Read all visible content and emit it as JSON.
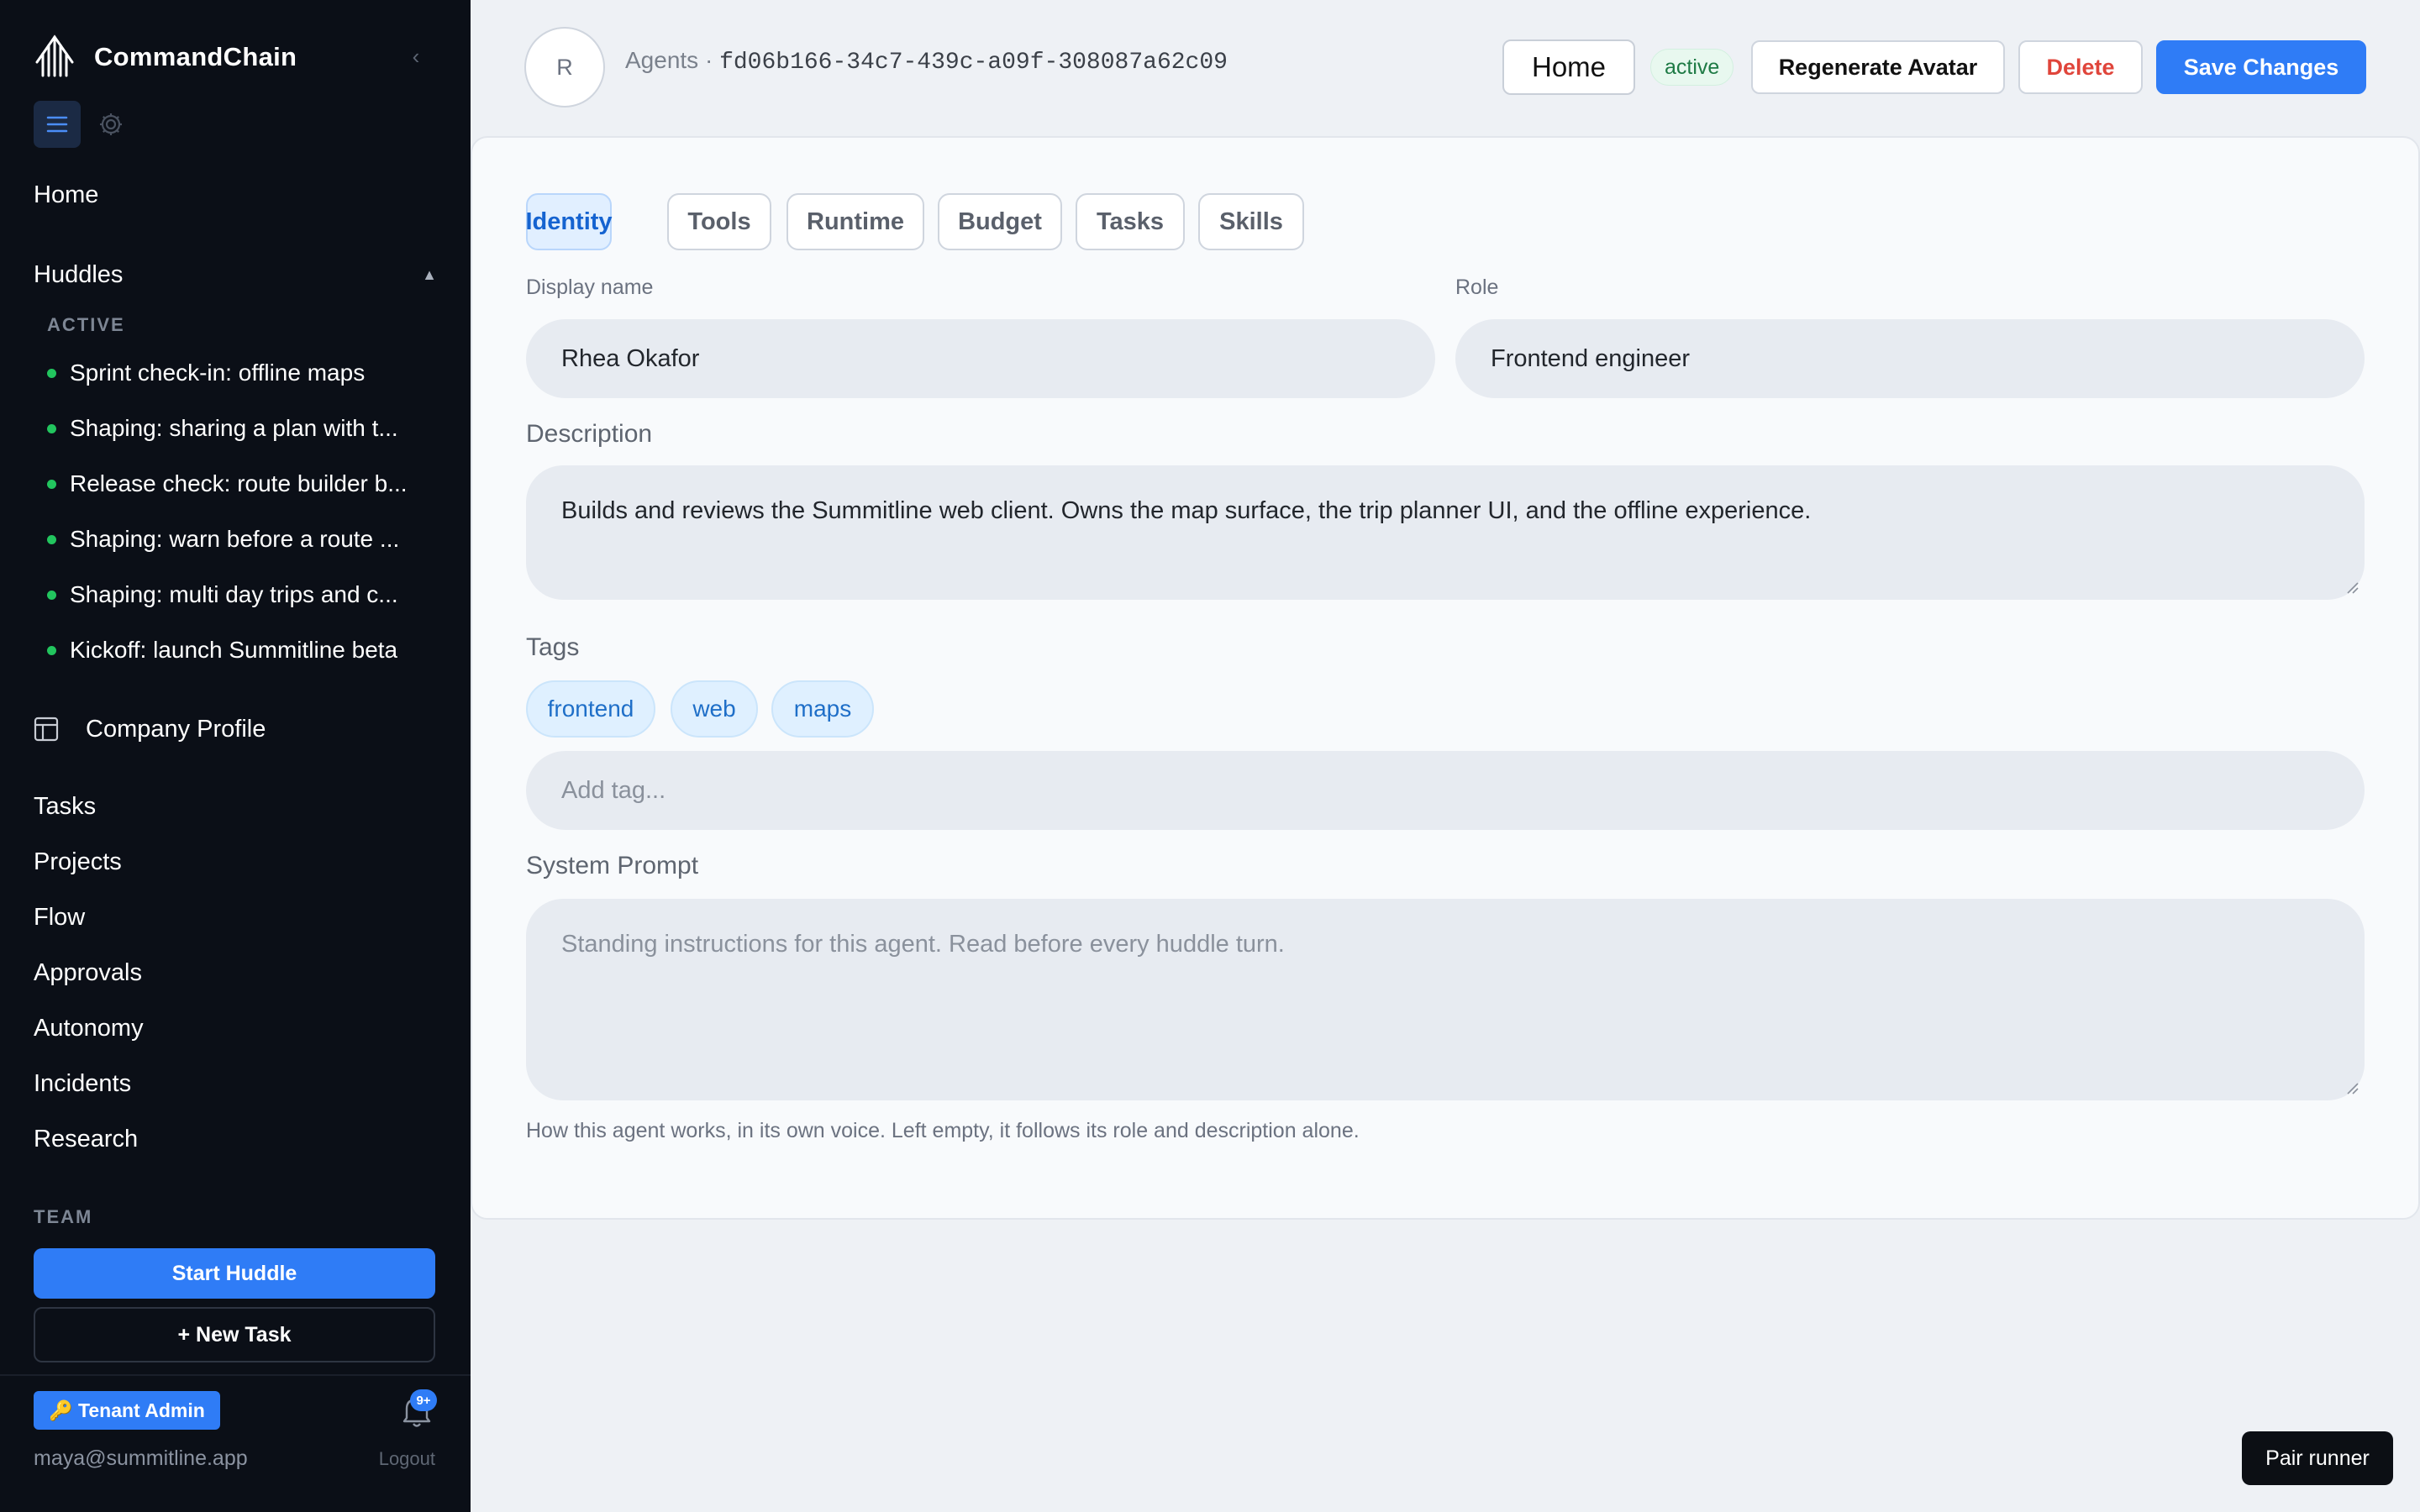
{
  "app": {
    "name": "CommandChain"
  },
  "sidebar": {
    "home": "Home",
    "huddles": {
      "label": "Huddles",
      "caret": "▲",
      "section": "ACTIVE",
      "items": [
        "Sprint check-in: offline maps",
        "Shaping: sharing a plan with t...",
        "Release check: route builder b...",
        "Shaping: warn before a route ...",
        "Shaping: multi day trips and c...",
        "Kickoff: launch Summitline beta"
      ]
    },
    "company_profile": "Company Profile",
    "nav": [
      "Tasks",
      "Projects",
      "Flow",
      "Approvals",
      "Autonomy",
      "Incidents",
      "Research"
    ],
    "team_label": "TEAM",
    "start_huddle": "Start Huddle",
    "new_task": "+ New Task",
    "tenant_admin": "🔑 Tenant Admin",
    "notifications_badge": "9+",
    "user_email": "maya@summitline.app",
    "logout": "Logout"
  },
  "header": {
    "avatar_initial": "R",
    "breadcrumb_prefix": "Agents · ",
    "agent_id": "fd06b166-34c7-439c-a09f-308087a62c09",
    "home_button": "Home",
    "status": "active",
    "regenerate_avatar": "Regenerate Avatar",
    "delete": "Delete",
    "save_changes": "Save Changes"
  },
  "tabs": [
    "Identity",
    "Tools",
    "Runtime",
    "Budget",
    "Tasks",
    "Skills"
  ],
  "active_tab": "Identity",
  "form": {
    "display_name_label": "Display name",
    "display_name": "Rhea Okafor",
    "role_label": "Role",
    "role": "Frontend engineer",
    "description_label": "Description",
    "description": "Builds and reviews the Summitline web client. Owns the map surface, the trip planner UI, and the offline experience.",
    "tags_label": "Tags",
    "tags": [
      "frontend",
      "web",
      "maps"
    ],
    "add_tag_placeholder": "Add tag...",
    "system_prompt_label": "System Prompt",
    "system_prompt_placeholder": "Standing instructions for this agent. Read before every huddle turn.",
    "system_prompt_hint": "How this agent works, in its own voice. Left empty, it follows its role and description alone."
  },
  "pair_runner": "Pair runner",
  "colors": {
    "accent": "#2f7cf6",
    "sidebar_bg": "#0b0f17",
    "danger": "#e0453b",
    "status_active": "#22c55e"
  }
}
